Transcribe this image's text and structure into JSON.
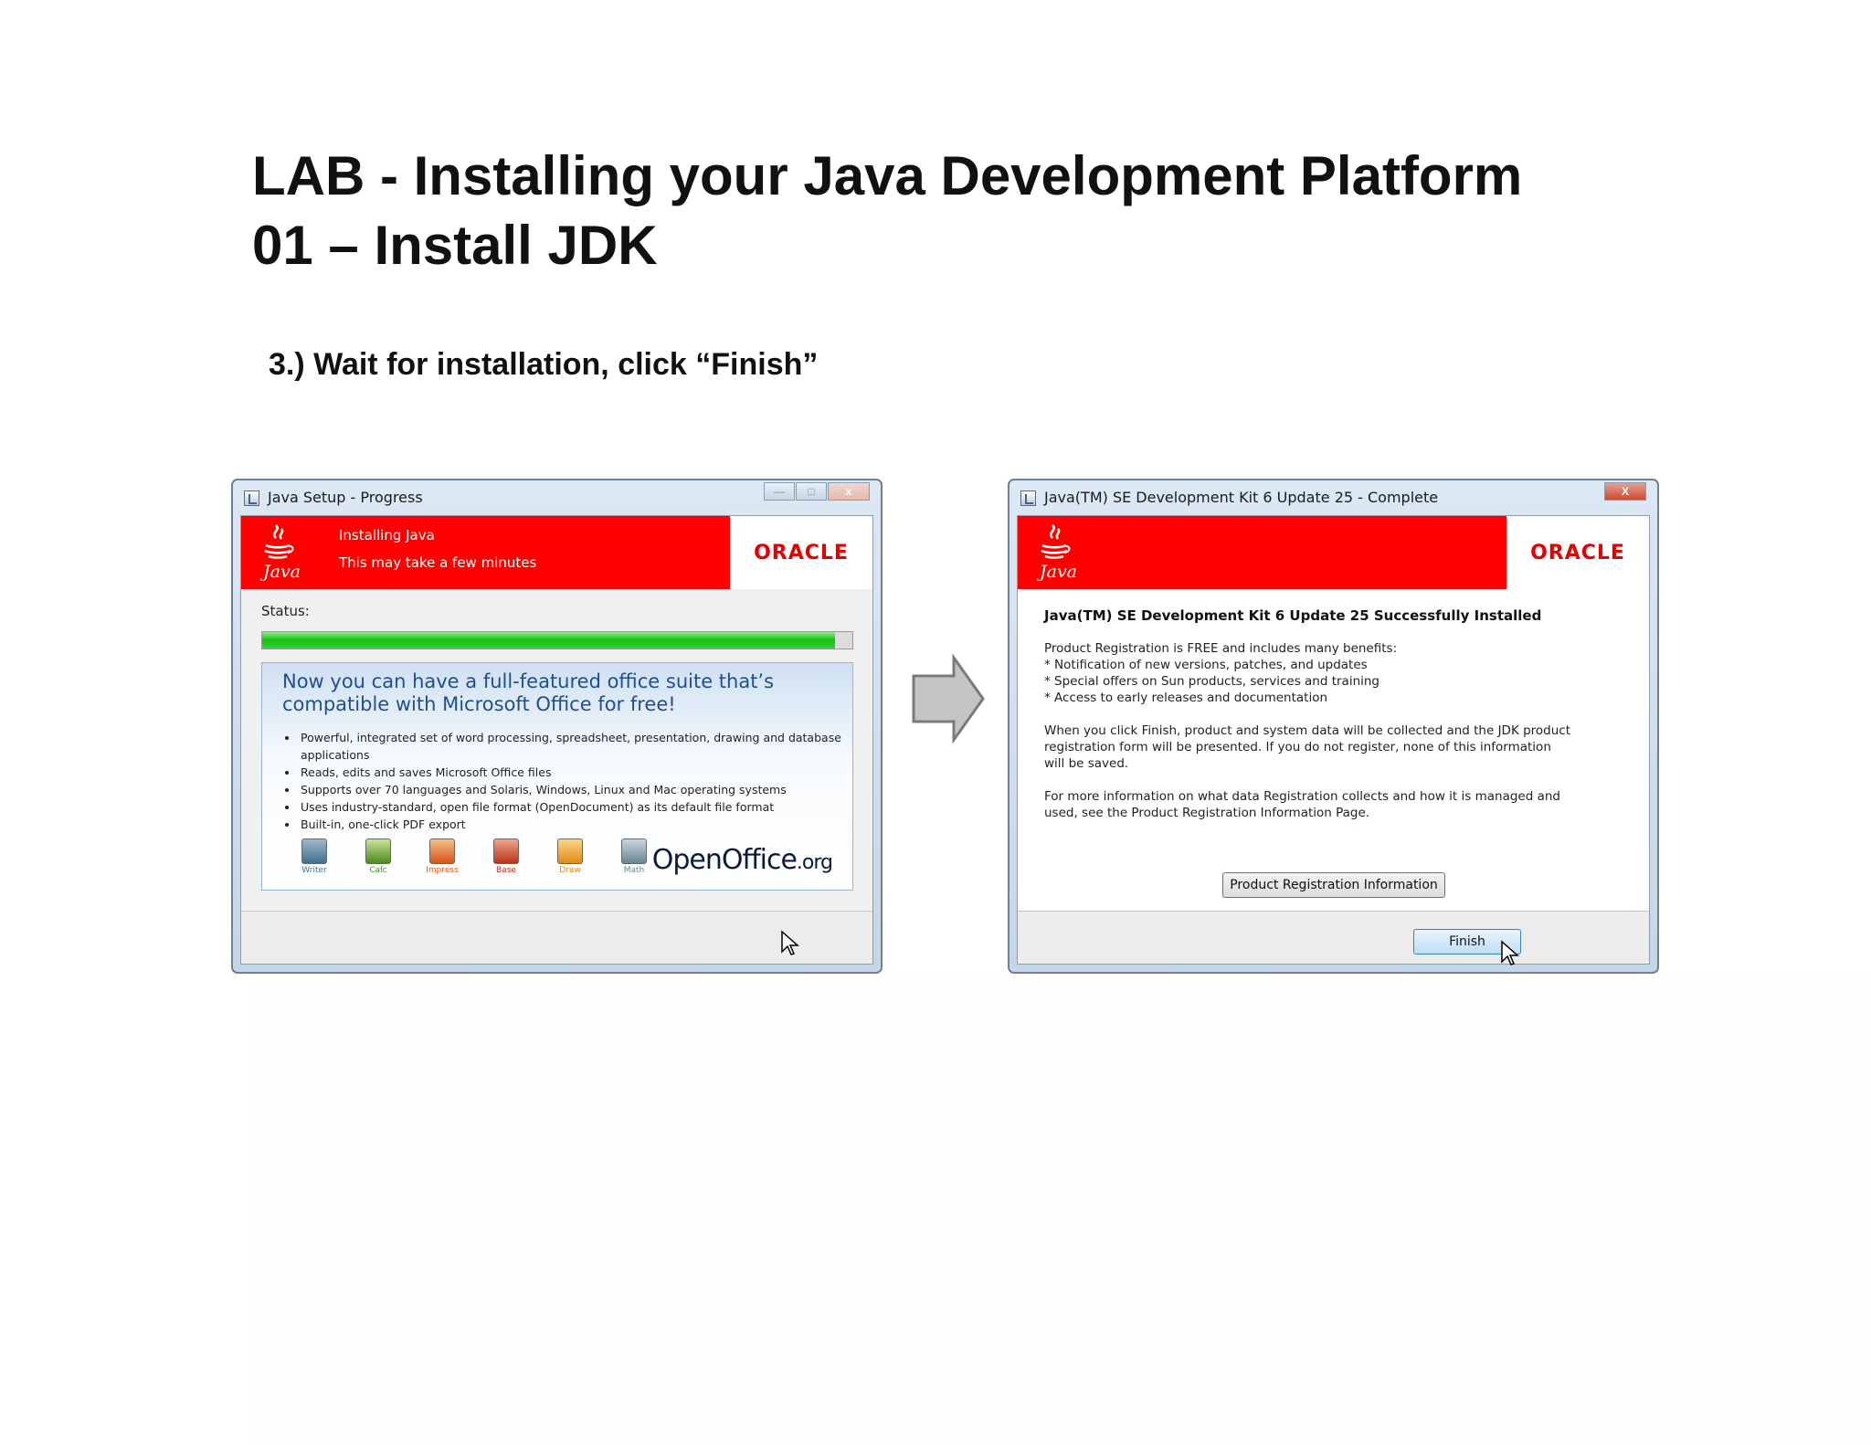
{
  "slide": {
    "title_line1": "LAB - Installing your Java Development Platform",
    "title_line2": "01 – Install JDK",
    "step": "3.) Wait for installation, click “Finish”"
  },
  "progress_window": {
    "title": "Java Setup - Progress",
    "banner_line1": "Installing Java",
    "banner_line2": "This may take a few minutes",
    "java_wordmark": "Java",
    "oracle_logo": "ORACLE",
    "status_label": "Status:",
    "progress": 0.97,
    "ad": {
      "headline": "Now you can have a full-featured office suite that’s compatible with Microsoft Office for free!",
      "bullets": [
        "Powerful, integrated set of word processing, spreadsheet, presentation, drawing and database applications",
        "Reads, edits and saves Microsoft Office files",
        "Supports over 70 languages and Solaris, Windows, Linux and Mac operating systems",
        "Uses industry-standard, open file format (OpenDocument) as its default file format",
        "Built-in, one-click PDF export"
      ],
      "apps": [
        "Writer",
        "Calc",
        "Impress",
        "Base",
        "Draw",
        "Math"
      ],
      "logo_main": "OpenOffice",
      "logo_suffix": ".org"
    },
    "controls": {
      "minimize": "—",
      "maximize": "□",
      "close": "x"
    }
  },
  "complete_window": {
    "title": "Java(TM) SE Development Kit 6 Update 25 - Complete",
    "java_wordmark": "Java",
    "oracle_logo": "ORACLE",
    "close": "X",
    "heading": "Java(TM) SE Development Kit 6 Update 25 Successfully Installed",
    "benefits_intro": "Product Registration is FREE and includes many benefits:",
    "benefits": [
      "* Notification of new versions, patches, and updates",
      "* Special offers on Sun products, services and training",
      "* Access to early releases and documentation"
    ],
    "finish_note": "When you click Finish, product and system data will be collected and the JDK product registration form will be presented. If you do not register, none of this information will be saved.",
    "more_info": "For more information on what data Registration collects and how it is managed and used, see the Product Registration Information Page.",
    "product_reg_button": "Product Registration Information",
    "finish_button": "Finish"
  },
  "colors": {
    "java_red": "#ff0000",
    "oracle_red": "#e20000",
    "progress_green": "#10c010",
    "ad_blue": "#1f4f8f"
  }
}
